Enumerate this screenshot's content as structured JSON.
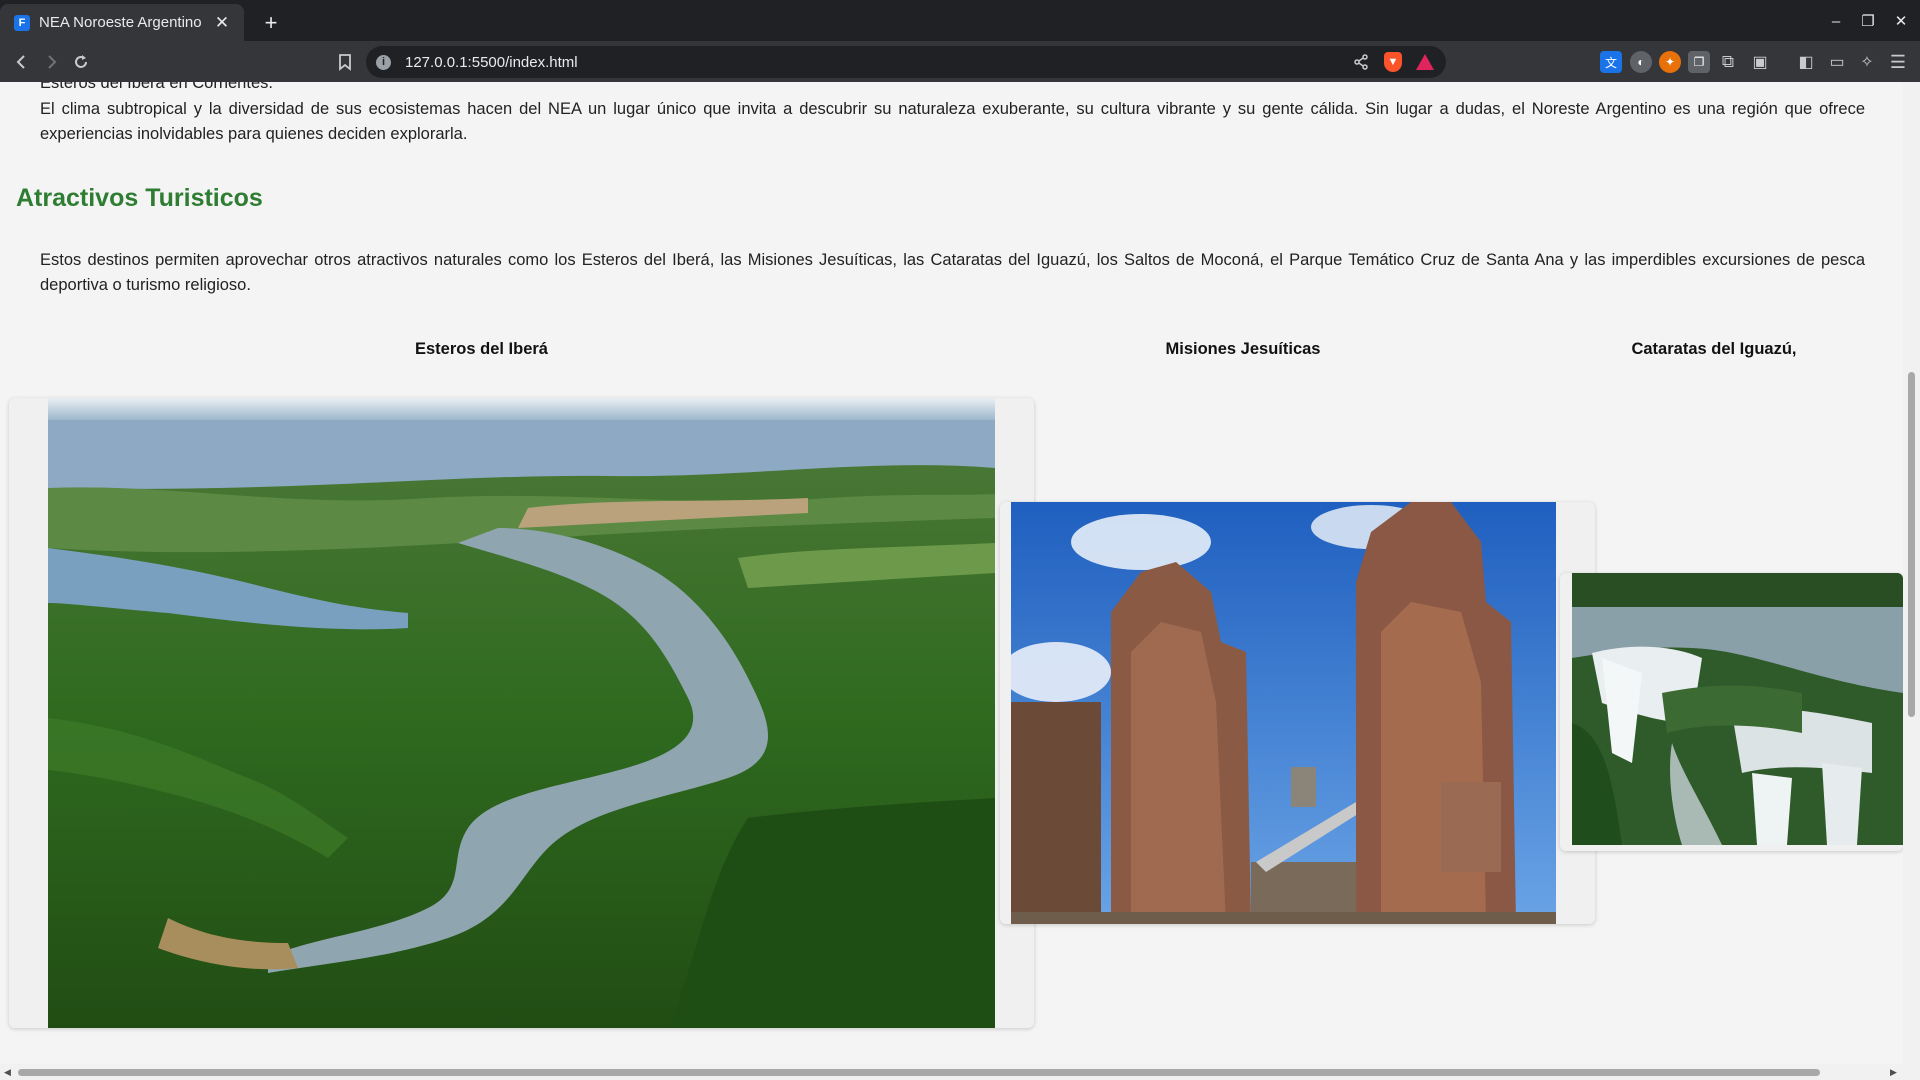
{
  "browser": {
    "tab_title": "NEA Noroeste Argentino",
    "favicon_letter": "F",
    "url": "127.0.0.1:5500/index.html"
  },
  "page": {
    "intro_fragment": "Esteros del Iberá en Corrientes.",
    "climate_paragraph": "El clima subtropical y la diversidad de sus ecosistemas hacen del NEA un lugar único que invita a descubrir su naturaleza exuberante, su cultura vibrante y su gente cálida. Sin lugar a dudas, el Noreste Argentino es una región que ofrece experiencias inolvidables para quienes deciden explorarla.",
    "section_title": "Atractivos Turisticos",
    "section_paragraph": "Estos destinos permiten aprovechar otros atractivos naturales como los Esteros del Iberá, las Misiones Jesuíticas, las Cataratas del Iguazú, los Saltos de Moconá, el Parque Temático Cruz de Santa Ana y las imperdibles excursiones de pesca deportiva o turismo religioso.",
    "attractions": [
      {
        "caption": "Esteros del Iberá",
        "image": "wetland-aerial-photo"
      },
      {
        "caption": "Misiones Jesuíticas",
        "image": "jesuit-ruins-photo"
      },
      {
        "caption": "Cataratas del Iguazú,",
        "image": "waterfalls-photo"
      }
    ]
  },
  "colors": {
    "section_title": "#2e7d32",
    "page_background": "#f4f4f4",
    "chrome_dark": "#202124",
    "chrome_toolbar": "#35363a"
  }
}
